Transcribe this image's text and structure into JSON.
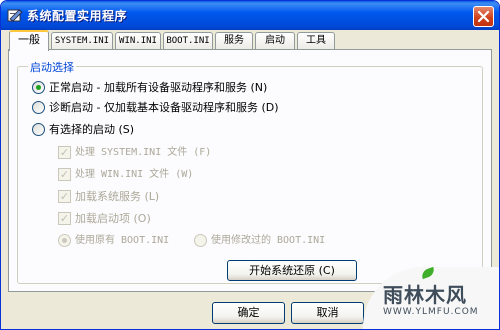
{
  "window": {
    "title": "系统配置实用程序"
  },
  "tabs": [
    {
      "label": "一般",
      "active": true
    },
    {
      "label": "SYSTEM.INI"
    },
    {
      "label": "WIN.INI"
    },
    {
      "label": "BOOT.INI"
    },
    {
      "label": "服务"
    },
    {
      "label": "启动"
    },
    {
      "label": "工具"
    }
  ],
  "startup": {
    "caption": "启动选择",
    "normal": "正常启动 - 加载所有设备驱动程序和服务 (N)",
    "diagnostic": "诊断启动 - 仅加载基本设备驱动程序和服务 (D)",
    "selective": "有选择的启动 (S)",
    "process_system": "处理 SYSTEM.INI 文件 (F)",
    "process_win": "处理 WIN.INI 文件 (W)",
    "load_services": "加载系统服务 (L)",
    "load_startup": "加载启动项 (O)",
    "use_original": "使用原有 BOOT.INI",
    "use_modified": "使用修改过的 BOOT.INI",
    "selected": "normal"
  },
  "buttons": {
    "system_restore": "开始系统还原 (C)",
    "ok": "确定",
    "cancel": "取消"
  },
  "watermark": {
    "text": "雨林木风",
    "url": "WWW.YLMFU.COM"
  },
  "colors": {
    "titlebar": "#0058ee",
    "group_caption": "#0046d5",
    "radio_dot": "#21a121",
    "tab_highlight": "#ffc83c"
  }
}
